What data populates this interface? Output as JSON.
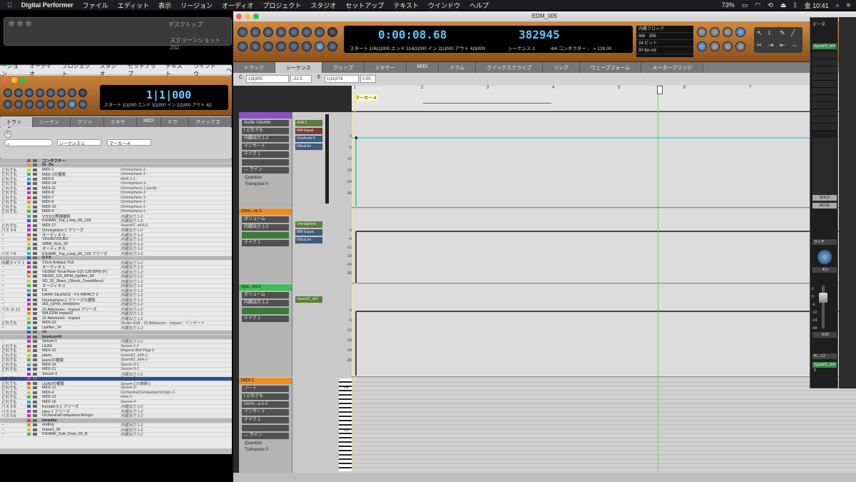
{
  "menubar": {
    "app": "Digital Performer",
    "items": [
      "ファイル",
      "エディット",
      "表示",
      "リージョン",
      "オーディオ",
      "プロジェクト",
      "スタジオ",
      "セットアップ",
      "テキスト",
      "ウインドウ",
      "ヘルプ"
    ],
    "battery": "73%",
    "time": "金 10:41"
  },
  "bg_window": {
    "title": "デスクトップ",
    "file": "スクリーンショット 202"
  },
  "left_window": {
    "menu": [
      "ージョン",
      "オーディオ",
      "プロジェクト",
      "スタジオ",
      "セットアップ",
      "テキスト",
      "ウインドウ",
      "ヘ"
    ],
    "counter": "1|1|000",
    "counter_info": "スタート 1|1|000   エンド 3|1|000   イン 1|1|000   アウト 4|1",
    "tabs": [
      "トラック",
      "シーケンス",
      "クリップ",
      "ミキサー",
      "MIDI",
      "ドラム",
      "クイックスク"
    ],
    "sequence_menu": "シーケンス-1",
    "marker_menu": "マーカー-4",
    "tracks": [
      {
        "c1": "",
        "name": "コンダクター",
        "out": "",
        "type": "folder"
      },
      {
        "c1": "",
        "name": "Dr_Ba",
        "out": "",
        "type": "folder"
      },
      {
        "c1": "どれでも",
        "name": "MIDI-1",
        "out": "Omnisphere-1-"
      },
      {
        "c1": "どれでも",
        "name": "MIDI-1の複製",
        "out": "Omnisphere-1-"
      },
      {
        "c1": "どれでも",
        "name": "MIDI-5",
        "out": "ANA 2-1-"
      },
      {
        "c1": "どれでも",
        "name": "MIDI-14",
        "out": "Omnisphere-1-"
      },
      {
        "c1": "どれでも",
        "name": "MIDI-11",
        "out": "Omnisphere-1 pump-"
      },
      {
        "c1": "どれでも",
        "name": "MIDI-8",
        "out": "Omnisphere-1-"
      },
      {
        "c1": "どれでも",
        "name": "MIDI-7",
        "out": "Omnisphere-1-"
      },
      {
        "c1": "どれでも",
        "name": "MIDI-6",
        "out": "Omnisphere-1-"
      },
      {
        "c1": "どれでも",
        "name": "MIDI-10",
        "out": "Omnisphere-1-"
      },
      {
        "c1": "どれでも",
        "name": "MIDI-9",
        "out": "Omnisphere-1-"
      },
      {
        "c1": "--",
        "name": "VTDS1等弾優和",
        "out": "内蔵出力 1-2"
      },
      {
        "c1": "--",
        "name": "KSHMR_Top_Loop_06_128",
        "out": "内蔵出力 1-2"
      },
      {
        "c1": "どれでも",
        "name": "MIDI-17",
        "out": "Xpand!2_x64-2-"
      },
      {
        "c1": "バス 3-4",
        "name": "Omnisphere-1 フリーズ",
        "out": "内蔵出力 1-2"
      },
      {
        "c1": "--",
        "name": "オーディオ-3",
        "out": "内蔵出力 1-2"
      },
      {
        "c1": "--",
        "name": "VDUB2VDUB2",
        "out": "内蔵出力 1-2"
      },
      {
        "c1": "--",
        "name": "SMW_Kick_20",
        "out": "内蔵出力 1-2"
      },
      {
        "c1": "--",
        "name": "オーディオ-5",
        "out": "内蔵出力 1-2"
      },
      {
        "c1": "バス 7-8",
        "name": "KSHMR_Top_Loop_06_128 フリーズ",
        "out": "内蔵出力 1-2"
      },
      {
        "c1": "",
        "name": "D-FX",
        "out": "",
        "type": "folder"
      },
      {
        "c1": "内蔵マイク 1",
        "name": "Clock Antique Tick",
        "out": "内蔵出力 1-2"
      },
      {
        "c1": "--",
        "name": "オーディオ-1",
        "out": "内蔵出力 1-2"
      },
      {
        "c1": "--",
        "name": "VEDM2 Tonal Riser 010 128 BPM (F)",
        "out": "内蔵出力 1-2"
      },
      {
        "c1": "--",
        "name": "SEDM_126_BPM_Uplifter_06",
        "out": "内蔵出力 1-2"
      },
      {
        "c1": "--",
        "name": "SD_02_2bars_(Shock_Downlifters)",
        "out": "内蔵出力 1-2"
      },
      {
        "c1": "--",
        "name": "オーディオ-2",
        "out": "内蔵出力 1-2"
      },
      {
        "c1": "--",
        "name": "FX",
        "out": "内蔵出力 1-2"
      },
      {
        "c1": "--",
        "name": "DARK SILENCE - FX IMPACT 2",
        "out": "内蔵出力 1-2"
      },
      {
        "c1": "--",
        "name": "Omnisphere-1 フリーズの複製",
        "out": "内蔵出力 1-2"
      },
      {
        "c1": "--",
        "name": "sk3_cymfx_wenplano",
        "out": "内蔵出力 1-2"
      },
      {
        "c1": "バス 11-12",
        "name": "15 Abletunes - Impact フリーズ",
        "out": "内蔵出力 1-2"
      },
      {
        "c1": "--",
        "name": "WA EDM Impact2",
        "out": "内蔵出力 1-2"
      },
      {
        "c1": "--",
        "name": "15 Abletunes - Impact",
        "out": "内蔵出力 1-2"
      },
      {
        "c1": "どれでも",
        "name": "MIDI-23",
        "out": "Stutter Edit - 15 Abletunes - Impact : インサート"
      },
      {
        "c1": "--",
        "name": "Uplifter_14",
        "out": "内蔵出力 1-2"
      },
      {
        "c1": "",
        "name": "vo",
        "out": "",
        "type": "folder"
      },
      {
        "c1": "",
        "name": "key&synth",
        "out": "",
        "type": "folder"
      },
      {
        "c1": "--",
        "name": "Serum-1",
        "out": "内蔵出力 1-2"
      },
      {
        "c1": "どれでも",
        "name": "LEAD",
        "out": "Serum-1-1"
      },
      {
        "c1": "どれでも",
        "name": "MIDI-22",
        "out": "Magical 8bit Plug-1-"
      },
      {
        "c1": "どれでも",
        "name": "piano",
        "out": "Xpand!2_x64-1-"
      },
      {
        "c1": "どれでも",
        "name": "pianoの複製",
        "out": "Xpand!2_x64-1-"
      },
      {
        "c1": "どれでも",
        "name": "MIDI-15",
        "out": "Serum-3-1"
      },
      {
        "c1": "どれでも",
        "name": "MIDI-21",
        "out": "Serum-3-1"
      },
      {
        "c1": "--",
        "name": "Serum-3",
        "out": "内蔵出力 1-2"
      },
      {
        "c1": "どれでも",
        "name": "",
        "out": "Serum-1-",
        "type": "selected"
      },
      {
        "c1": "どれでも",
        "name": "LEADの複製",
        "out": "Serum-1の複製-1"
      },
      {
        "c1": "どれでも",
        "name": "MIDI-12",
        "out": "Serum-2-"
      },
      {
        "c1": "どれでも",
        "name": "MIDI-4",
        "out": "OrchestralCompanionStrings-1-"
      },
      {
        "c1": "どれでも",
        "name": "MIDI-13",
        "out": "Hive-1-"
      },
      {
        "c1": "どれでも",
        "name": "MIDI-16",
        "out": "Serum-4-"
      },
      {
        "c1": "バス 5-6",
        "name": "Kontakt 5-1 フリーズ",
        "out": "内蔵出力 1-2"
      },
      {
        "c1": "バス 5-6",
        "name": "Hive-1 フリーズ",
        "out": "内蔵出力 1-2"
      },
      {
        "c1": "バス 5-6",
        "name": "OrchestralCompanionStrings-",
        "out": "内蔵出力 1-2"
      },
      {
        "c1": "",
        "name": "karaoke",
        "out": "",
        "type": "folder"
      },
      {
        "c1": "--",
        "name": "ending",
        "out": "内蔵出力 1-2"
      },
      {
        "c1": "--",
        "name": "Impact_05",
        "out": "内蔵出力 1-2"
      },
      {
        "c1": "--",
        "name": "KSHMR_Sub_Drop_03_B",
        "out": "内蔵出力 1-2"
      }
    ]
  },
  "main_window": {
    "title": "EDM_005",
    "time": "0:00:08.68",
    "samples": "382945",
    "info1": "スタート 106|1|000   エンド 114|1|000   イン 2|1|000   アウト 4|3|000",
    "sequence": "シーケンス-1",
    "conductor": "4/4 コンダクター ♩ = 128.00",
    "clock": {
      "source": "内蔵クロック",
      "rate": "48k",
      "buffer": "256",
      "bits": "24 ビット",
      "fps": "30 fps nd"
    },
    "tabs": [
      "トラック",
      "シーケンス",
      "クリップ",
      "ミキサー",
      "MIDI",
      "ドラム",
      "クイックスクライブ",
      "ソング",
      "ウェーブフォーム",
      "メーターブリッジ"
    ],
    "toolbar": {
      "c_field": "1|3|305",
      "c_val": "-22.5",
      "e_field": "1|11|078",
      "e_val": "0.00",
      "c_label": "C",
      "e_label": "E"
    },
    "ruler": {
      "marker": "マーカー-4",
      "bars": [
        "1",
        "2",
        "3",
        "4",
        "5",
        "6",
        "7"
      ]
    },
    "tracks": [
      {
        "header": "",
        "selects": [
          "Audio Volume",
          "I どれでも",
          "内蔵出力 1-2",
          "インサート",
          "テイク 1",
          "",
          "--- ライン"
        ],
        "quantize": "Quantize",
        "transpose": "Transpose",
        "transpose_val": "0",
        "plugins": [
          "ANA 2",
          "MW Equal..",
          "OneKnob P",
          "EBusLim"
        ],
        "axis": [
          "0",
          "-6",
          "-12",
          "-18",
          "-24",
          "-36"
        ]
      },
      {
        "header": "Omn...re-1",
        "selects": [
          "ボリューム",
          "内蔵出力 1-2",
          "",
          "テイク 1"
        ],
        "plugins": [
          "Omnisphere",
          "MW Equal..",
          "EBusLim"
        ],
        "axis": [
          "0",
          "-6",
          "-12",
          "-18",
          "-24",
          "-36"
        ]
      },
      {
        "header": "Xpa...64-2",
        "selects": [
          "ボリューム",
          "内蔵出力 1-2",
          "",
          "テイク 1"
        ],
        "plugins": [
          "Xpand!2_x64"
        ],
        "axis": [
          "0",
          "-6",
          "-12",
          "-18",
          "-24",
          "-36"
        ]
      },
      {
        "header": "MIDI-1",
        "selects": [
          "ノート",
          "I どれでも",
          "Omni...a-1-1",
          "インサート",
          "テイク 1",
          "",
          "--- ライン"
        ],
        "quantize": "Quantize",
        "transpose": "Transpose",
        "transpose_val": "0",
        "piano_labels": [
          "C4",
          "C3"
        ]
      }
    ]
  },
  "mixer": {
    "title": "データ",
    "plugin": "Xpand!2_x64",
    "solo": "SOLO",
    "mute": "MUTE",
    "latch": "ラッチ",
    "pan": "41>",
    "level": "0.00",
    "scale": [
      "6",
      "0",
      "-6",
      "-12",
      "-24",
      "-48"
    ],
    "output": "Pi...1-2",
    "channel": "Xpand!2_x64-2"
  },
  "colors": {
    "accent_blue": "#56c8ff",
    "transport_orange": "#c7833e",
    "track_orange": "#ea8d25",
    "track_green": "#3fbf5a"
  }
}
